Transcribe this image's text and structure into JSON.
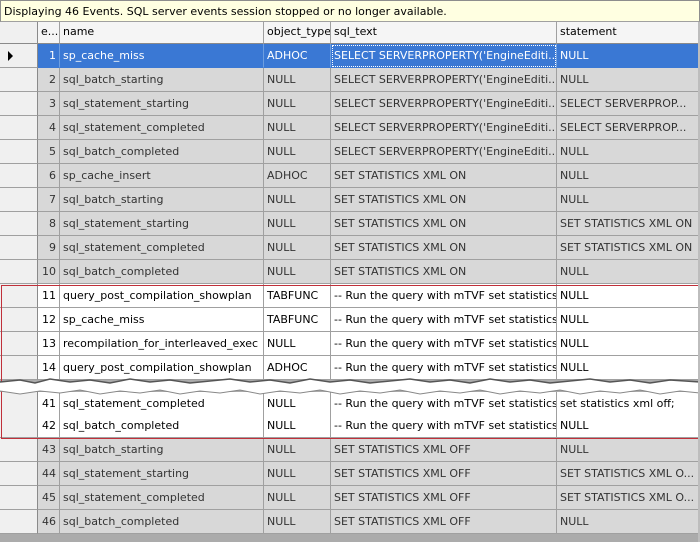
{
  "status": {
    "message": "Displaying 46 Events. SQL server events session stopped or no longer available."
  },
  "columns": {
    "e": "e...",
    "name": "name",
    "object_type": "object_type",
    "sql_text": "sql_text",
    "statement": "statement"
  },
  "rows": [
    {
      "e": "1",
      "name": "sp_cache_miss",
      "object_type": "ADHOC",
      "sql_text": "SELECT SERVERPROPERTY('EngineEditi...",
      "statement": "NULL"
    },
    {
      "e": "2",
      "name": "sql_batch_starting",
      "object_type": "NULL",
      "sql_text": "SELECT SERVERPROPERTY('EngineEditi...",
      "statement": "NULL"
    },
    {
      "e": "3",
      "name": "sql_statement_starting",
      "object_type": "NULL",
      "sql_text": "SELECT SERVERPROPERTY('EngineEditi...",
      "statement": "SELECT SERVERPROP..."
    },
    {
      "e": "4",
      "name": "sql_statement_completed",
      "object_type": "NULL",
      "sql_text": "SELECT SERVERPROPERTY('EngineEditi...",
      "statement": "SELECT SERVERPROP..."
    },
    {
      "e": "5",
      "name": "sql_batch_completed",
      "object_type": "NULL",
      "sql_text": "SELECT SERVERPROPERTY('EngineEditi...",
      "statement": "NULL"
    },
    {
      "e": "6",
      "name": "sp_cache_insert",
      "object_type": "ADHOC",
      "sql_text": "SET STATISTICS XML ON",
      "statement": "NULL"
    },
    {
      "e": "7",
      "name": "sql_batch_starting",
      "object_type": "NULL",
      "sql_text": "SET STATISTICS XML ON",
      "statement": "NULL"
    },
    {
      "e": "8",
      "name": "sql_statement_starting",
      "object_type": "NULL",
      "sql_text": "SET STATISTICS XML ON",
      "statement": "SET STATISTICS XML ON"
    },
    {
      "e": "9",
      "name": "sql_statement_completed",
      "object_type": "NULL",
      "sql_text": "SET STATISTICS XML ON",
      "statement": "SET STATISTICS XML ON"
    },
    {
      "e": "10",
      "name": "sql_batch_completed",
      "object_type": "NULL",
      "sql_text": "SET STATISTICS XML ON",
      "statement": "NULL"
    },
    {
      "e": "11",
      "name": "query_post_compilation_showplan",
      "object_type": "TABFUNC",
      "sql_text": "-- Run the query with mTVF  set statistics xm...",
      "statement": "NULL"
    },
    {
      "e": "12",
      "name": "sp_cache_miss",
      "object_type": "TABFUNC",
      "sql_text": "-- Run the query with mTVF  set statistics xm...",
      "statement": "NULL"
    },
    {
      "e": "13",
      "name": "recompilation_for_interleaved_exec",
      "object_type": "NULL",
      "sql_text": "-- Run the query with mTVF  set statistics xm...",
      "statement": "NULL"
    },
    {
      "e": "14",
      "name": "query_post_compilation_showplan",
      "object_type": "ADHOC",
      "sql_text": "-- Run the query with mTVF  set statistics xm...",
      "statement": "NULL"
    },
    {
      "e": "41",
      "name": "sql_statement_completed",
      "object_type": "NULL",
      "sql_text": "-- Run the query with mTVF  set statistics xm...",
      "statement": "set statistics xml off;"
    },
    {
      "e": "42",
      "name": "sql_batch_completed",
      "object_type": "NULL",
      "sql_text": "-- Run the query with mTVF  set statistics xm...",
      "statement": "NULL"
    },
    {
      "e": "43",
      "name": "sql_batch_starting",
      "object_type": "NULL",
      "sql_text": "SET STATISTICS XML OFF",
      "statement": "NULL"
    },
    {
      "e": "44",
      "name": "sql_statement_starting",
      "object_type": "NULL",
      "sql_text": "SET STATISTICS XML OFF",
      "statement": "SET STATISTICS XML O..."
    },
    {
      "e": "45",
      "name": "sql_statement_completed",
      "object_type": "NULL",
      "sql_text": "SET STATISTICS XML OFF",
      "statement": "SET STATISTICS XML O..."
    },
    {
      "e": "46",
      "name": "sql_batch_completed",
      "object_type": "NULL",
      "sql_text": "SET STATISTICS XML OFF",
      "statement": "NULL"
    }
  ],
  "colors": {
    "selected": "#3a78d4",
    "gray_row": "#d8d8d8",
    "highlight": "#c0303a",
    "status_bg": "#ffffe1"
  },
  "icons": {
    "current_row": "row-pointer-arrow-icon"
  }
}
